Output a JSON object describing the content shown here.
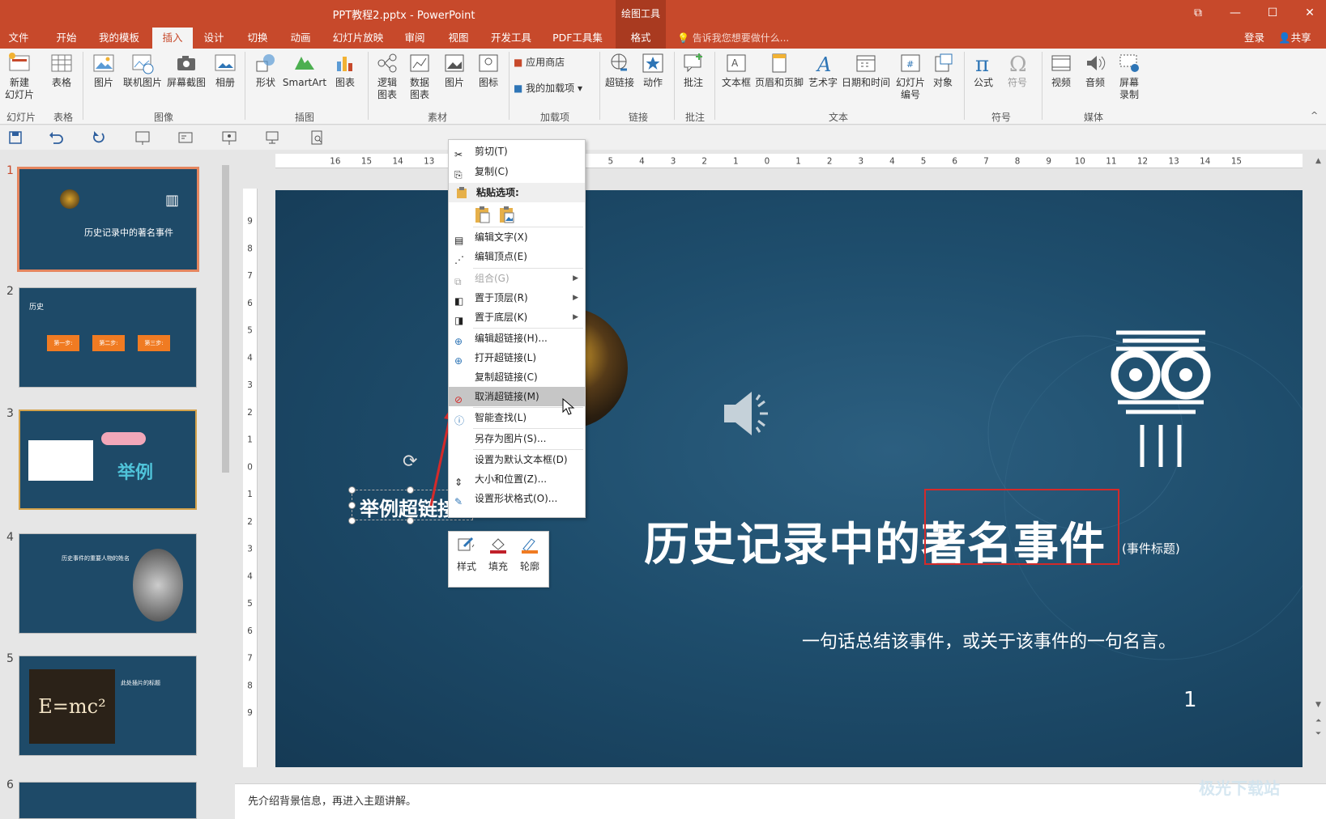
{
  "window": {
    "title": "PPT教程2.pptx - PowerPoint",
    "contextual_tab_group": "绘图工具"
  },
  "tabs": [
    "文件",
    "开始",
    "我的模板",
    "插入",
    "设计",
    "切换",
    "动画",
    "幻灯片放映",
    "审阅",
    "视图",
    "开发工具",
    "PDF工具集",
    "格式"
  ],
  "active_tab": "插入",
  "tell_me": "告诉我您想要做什么...",
  "account": {
    "login": "登录",
    "share": "共享"
  },
  "ribbon": {
    "buttons": {
      "new_slide": "新建\n幻灯片",
      "table": "表格",
      "picture": "图片",
      "online_picture": "联机图片",
      "screenshot": "屏幕截图",
      "album": "相册",
      "shapes": "形状",
      "smartart": "SmartArt",
      "chart": "图表",
      "logic_chart": "逻辑\n图表",
      "data_chart": "数据\n图表",
      "material_picture": "图片",
      "icon": "图标",
      "app_store": "应用商店",
      "my_addins": "我的加载项",
      "hyperlink": "超链接",
      "action": "动作",
      "comment": "批注",
      "textbox": "文本框",
      "header_footer": "页眉和页脚",
      "wordart": "艺术字",
      "datetime": "日期和时间",
      "slide_number": "幻灯片\n编号",
      "object": "对象",
      "equation": "公式",
      "symbol": "符号",
      "video": "视频",
      "audio": "音频",
      "screen_record": "屏幕\n录制"
    },
    "groups": {
      "slides": "幻灯片",
      "tables": "表格",
      "images": "图像",
      "illustrations": "插图",
      "materials": "素材",
      "addins": "加载项",
      "links": "链接",
      "comments": "批注",
      "text": "文本",
      "symbols": "符号",
      "media": "媒体"
    }
  },
  "context_menu": {
    "items": [
      {
        "label": "剪切(T)",
        "icon": "scissors-icon"
      },
      {
        "label": "复制(C)",
        "icon": "copy-icon"
      },
      {
        "label": "粘贴选项:",
        "icon": "paste-icon"
      },
      {
        "label": "编辑文字(X)",
        "icon": "edit-text-icon"
      },
      {
        "label": "编辑顶点(E)",
        "icon": "edit-points-icon"
      },
      {
        "label": "组合(G)",
        "icon": "group-icon",
        "disabled": true,
        "submenu": true
      },
      {
        "label": "置于顶层(R)",
        "icon": "bring-front-icon",
        "submenu": true
      },
      {
        "label": "置于底层(K)",
        "icon": "send-back-icon",
        "submenu": true
      },
      {
        "label": "编辑超链接(H)...",
        "icon": "edit-link-icon"
      },
      {
        "label": "打开超链接(L)",
        "icon": "open-link-icon"
      },
      {
        "label": "复制超链接(C)",
        "icon": ""
      },
      {
        "label": "取消超链接(M)",
        "icon": "remove-link-icon",
        "highlighted": true
      },
      {
        "label": "智能查找(L)",
        "icon": "smart-lookup-icon"
      },
      {
        "label": "另存为图片(S)...",
        "icon": ""
      },
      {
        "label": "设置为默认文本框(D)",
        "icon": ""
      },
      {
        "label": "大小和位置(Z)...",
        "icon": "size-position-icon"
      },
      {
        "label": "设置形状格式(O)...",
        "icon": "format-shape-icon"
      }
    ]
  },
  "mini_toolbar": {
    "style": "样式",
    "fill": "填充",
    "outline": "轮廓"
  },
  "thumbnails": {
    "numbers": [
      "1",
      "2",
      "3",
      "4",
      "5",
      "6"
    ],
    "slide1_title": "历史记录中的著名事件",
    "slide2_title": "历史",
    "slide2_steps": [
      "第一步:",
      "第二步:",
      "第三步:"
    ],
    "slide3_text": "举例",
    "slide4_title": "历史事件的重要人物的姓名",
    "slide5_formula": "E=mc²",
    "slide5_title": "此处插片的标题"
  },
  "slide": {
    "title_normal": "历史记录中的",
    "title_highlight": "著名事件",
    "title_note": "(事件标题)",
    "quote": "一句话总结该事件，或关于该事件的一句名言。",
    "page_number": "1",
    "selected_textbox": "举例超链接"
  },
  "notes": "先介绍背景信息，再进入主题讲解。",
  "ruler": {
    "h_labels": [
      "16",
      "15",
      "14",
      "13",
      "12",
      "6",
      "5",
      "4",
      "3",
      "2",
      "1",
      "0",
      "1",
      "2",
      "3",
      "4",
      "5",
      "6",
      "7",
      "8",
      "9",
      "10",
      "11",
      "12",
      "13",
      "14",
      "15",
      "16"
    ],
    "v_labels": [
      "9",
      "8",
      "7",
      "6",
      "5",
      "4",
      "3",
      "2",
      "1",
      "0",
      "1",
      "2",
      "3",
      "4",
      "5",
      "6",
      "7",
      "8",
      "9"
    ]
  },
  "watermark": "极光下载站",
  "colors": {
    "accent": "#c7492b",
    "slide_bg": "#1e4d6c",
    "highlight_box": "#d42a2a"
  }
}
